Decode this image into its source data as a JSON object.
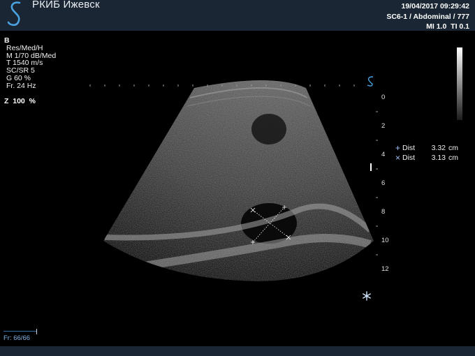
{
  "header": {
    "site_name": "РКИБ Ижевск",
    "datetime": "19/04/2017 09:29:42",
    "probe_preset": "SC6-1 / Abdominal / 777",
    "indices": "MI 1.0  TI 0.1"
  },
  "params": {
    "mode": "B",
    "lines": [
      "Res/Med/H",
      "M 1/70 dB/Med",
      "T 1540 m/s",
      "SC/SR 5",
      "G 60 %",
      "Fr. 24 Hz"
    ]
  },
  "zoom": "Z  100  %",
  "measurements": [
    {
      "symbol": "+",
      "label": "Dist",
      "value": "3.32",
      "unit": "cm"
    },
    {
      "symbol": "×",
      "label": "Dist",
      "value": "3.13",
      "unit": "cm"
    }
  ],
  "depth_scale": [
    "0",
    "2",
    "4",
    "6",
    "8",
    "10",
    "12"
  ],
  "frame_counter": "Fr: 66/66",
  "icons": {
    "logo": "s-logo-icon",
    "freeze": "snowflake-icon",
    "orientation": "s-orientation-icon"
  },
  "colors": {
    "bar": "#1a2633",
    "accent": "#7fb4e6",
    "caliper": "#ffffff"
  }
}
